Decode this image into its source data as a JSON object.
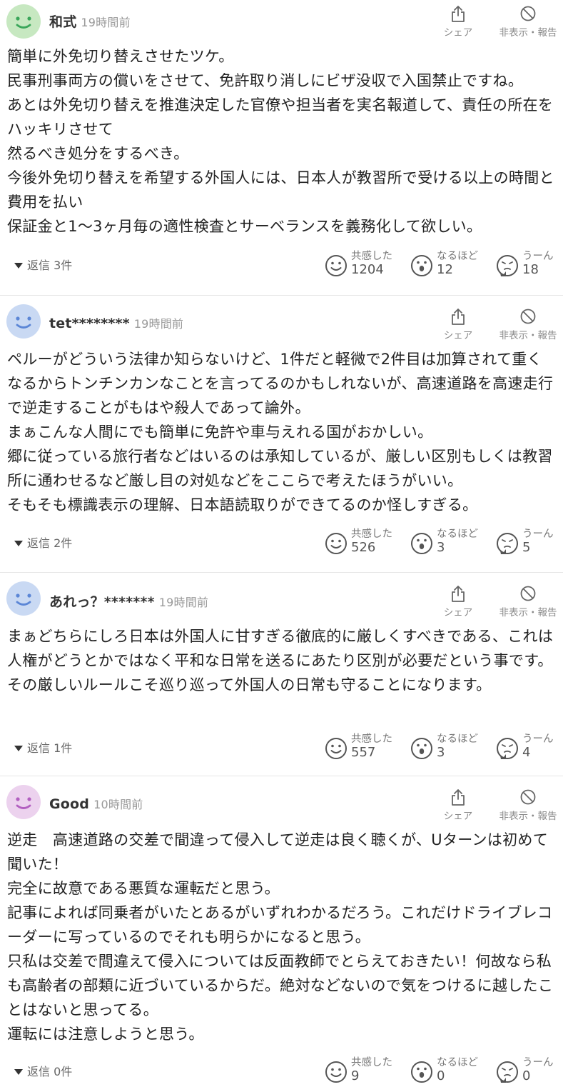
{
  "reaction_labels": {
    "empathy": "共感した",
    "naruhodo": "なるほど",
    "uun": "うーん"
  },
  "actions": {
    "share": "シェア",
    "report": "非表示・報告"
  },
  "comments": [
    {
      "user": "和式",
      "time": "19時間前",
      "avatar_color": "#c7e8c1",
      "face_color": "#3aa65a",
      "body": "簡単に外免切り替えさせたツケ。\n民事刑事両方の償いをさせて、免許取り消しにビザ没収で入国禁止ですね。\nあとは外免切り替えを推進決定した官僚や担当者を実名報道して、責任の所在をハッキリさせて\n然るべき処分をするべき。\n今後外免切り替えを希望する外国人には、日本人が教習所で受ける以上の時間と費用を払い\n保証金と1〜3ヶ月毎の適性検査とサーベランスを義務化して欲しい。",
      "replies": "返信 3件",
      "empathy": "1204",
      "naruhodo": "12",
      "uun": "18"
    },
    {
      "user": "tet********",
      "time": "19時間前",
      "avatar_color": "#c9d9f3",
      "face_color": "#5b86d6",
      "body": "ペルーがどういう法律か知らないけど、1件だと軽微で2件目は加算されて重くなるからトンチンカンなことを言ってるのかもしれないが、高速道路を高速走行で逆走することがもはや殺人であって論外。\nまぁこんな人間にでも簡単に免許や車与えれる国がおかしい。\n郷に従っている旅行者などはいるのは承知しているが、厳しい区別もしくは教習所に通わせるなど厳し目の対処などをここらで考えたほうがいい。\nそもそも標識表示の理解、日本語読取りができてるのか怪しすぎる。",
      "replies": "返信 2件",
      "empathy": "526",
      "naruhodo": "3",
      "uun": "5"
    },
    {
      "user": "あれっ？*******",
      "time": "19時間前",
      "avatar_color": "#c9d9f3",
      "face_color": "#5b86d6",
      "body": "まぁどちらにしろ日本は外国人に甘すぎる徹底的に厳しくすべきである、これは人権がどうとかではなく平和な日常を送るにあたり区別が必要だという事です。その厳しいルールこそ巡り巡って外国人の日常も守ることになります。",
      "replies": "返信 1件",
      "empathy": "557",
      "naruhodo": "3",
      "uun": "4"
    },
    {
      "user": "Good",
      "time": "10時間前",
      "avatar_color": "#ecd2ee",
      "face_color": "#b25fc0",
      "body": "逆走　高速道路の交差で間違って侵入して逆走は良く聴くが、Uターンは初めて聞いた！\n完全に故意である悪質な運転だと思う。\n記事によれば同乗者がいたとあるがいずれわかるだろう。これだけドライブレコーダーに写っているのでそれも明らかになると思う。\n只私は交差で間違えて侵入については反面教師でとらえておきたい！何故なら私も高齢者の部類に近づいているからだ。絶対などないので気をつけるに越したことはないと思ってる。\n運転には注意しようと思う。",
      "replies": "返信 0件",
      "empathy": "9",
      "naruhodo": "0",
      "uun": "0"
    }
  ]
}
